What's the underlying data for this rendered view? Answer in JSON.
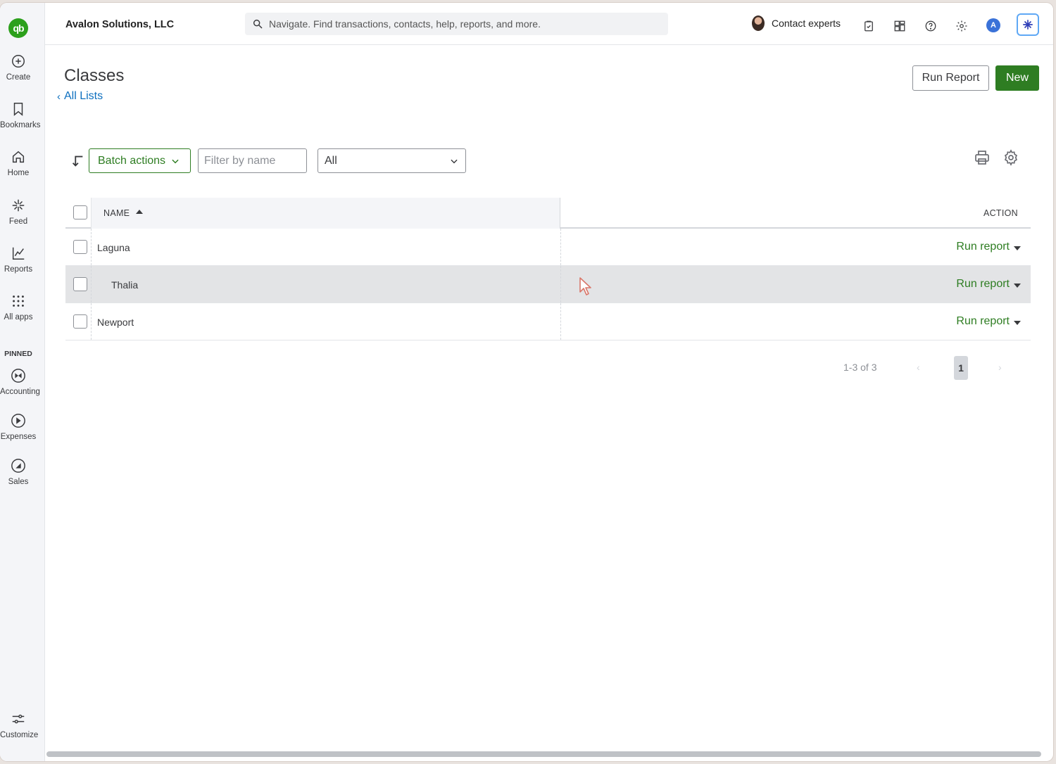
{
  "topbar": {
    "company": "Avalon Solutions, LLC",
    "search_placeholder": "Navigate. Find transactions, contacts, help, reports, and more.",
    "contact_label": "Contact experts",
    "avatar_letter": "A"
  },
  "rail": {
    "logo": "qb",
    "items": [
      {
        "label": "Create",
        "icon": "plus-circle-icon"
      },
      {
        "label": "Bookmarks",
        "icon": "bookmark-icon"
      },
      {
        "label": "Home",
        "icon": "home-icon"
      },
      {
        "label": "Feed",
        "icon": "feed-icon"
      },
      {
        "label": "Reports",
        "icon": "chart-line-icon"
      },
      {
        "label": "All apps",
        "icon": "grid-dots-icon"
      }
    ],
    "pinned_label": "PINNED",
    "pinned": [
      {
        "label": "Accounting",
        "icon": "accounting-icon"
      },
      {
        "label": "Expenses",
        "icon": "expenses-icon"
      },
      {
        "label": "Sales",
        "icon": "sales-icon"
      }
    ],
    "customize_label": "Customize"
  },
  "page": {
    "title": "Classes",
    "back_link": "All Lists",
    "run_report_btn": "Run Report",
    "new_btn": "New"
  },
  "toolbar": {
    "batch_actions": "Batch actions",
    "filter_placeholder": "Filter by name",
    "status_select": "All"
  },
  "table": {
    "col_name": "NAME",
    "col_action": "ACTION",
    "rows": [
      {
        "name": "Laguna",
        "action": "Run report",
        "indent": false
      },
      {
        "name": "Thalia",
        "action": "Run report",
        "indent": true
      },
      {
        "name": "Newport",
        "action": "Run report",
        "indent": false
      }
    ]
  },
  "pager": {
    "range": "1-3 of 3",
    "prev": "‹",
    "page": "1",
    "next": "›"
  },
  "colors": {
    "brand_green": "#2e7d22",
    "link_blue": "#0d6fbf",
    "logo_green": "#2ca01c"
  }
}
